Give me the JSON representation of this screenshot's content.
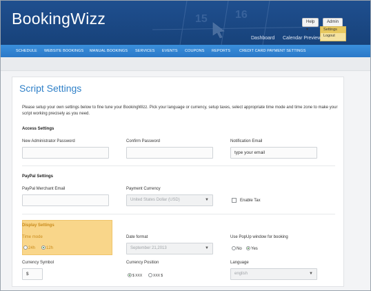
{
  "app": {
    "name": "BookingWizz"
  },
  "header": {
    "help_label": "Help",
    "admin_label": "Admin",
    "dropdown_items": [
      "Settings",
      "Logout"
    ],
    "links": [
      "Dashboard",
      "Calendar Preview"
    ],
    "calendar_numbers": [
      "15",
      "16"
    ]
  },
  "nav": {
    "items": [
      "SCHEDULE",
      "WEBSITE BOOKINGS",
      "MANUAL BOOKINGS",
      "SERVICES",
      "EVENTS",
      "COUPONS",
      "REPORTS",
      "CREDIT CARD PAYMENT SETTINGS"
    ]
  },
  "page": {
    "title": "Script Settings",
    "intro": "Please setup your own settings below to fine tune your BookingWizz. Pick your language or currency, setup taxes, select appropriate time mode and time zone to make your script working precisely as you need."
  },
  "access": {
    "heading": "Access Settings",
    "new_password_label": "New Administrator Password",
    "new_password_value": "",
    "confirm_password_label": "Confirm Password",
    "confirm_password_value": "",
    "notification_email_label": "Notification Email",
    "notification_email_value": "type your email"
  },
  "paypal": {
    "heading": "PayPal Settings",
    "merchant_email_label": "PayPal Merchant Email",
    "merchant_email_value": "",
    "currency_label": "Payment Currency",
    "currency_value": "United States Dollar (USD)",
    "tax_label": "Enable Tax",
    "tax_checked": false
  },
  "display": {
    "heading": "Display Settings",
    "time_mode_label": "Time mode",
    "time_mode_options": [
      "24h",
      "12h"
    ],
    "time_mode_selected": "12h",
    "date_format_label": "Date format",
    "date_format_value": "September 21,2013",
    "popup_label": "Use PopUp window for booking",
    "popup_options": [
      "No",
      "Yes"
    ],
    "popup_selected": "Yes",
    "currency_symbol_label": "Currency Symbol",
    "currency_symbol_value": "$",
    "currency_position_label": "Currency Position",
    "currency_position_options": [
      "$ XXX",
      "XXX $"
    ],
    "currency_position_selected": "$ XXX",
    "language_label": "Language",
    "language_value": "english"
  },
  "colors": {
    "header_blue": "#1f4f8f",
    "nav_blue": "#2b79c8",
    "title_blue": "#2f80c8",
    "highlight_yellow": "#f9d68a",
    "highlight_text": "#c98a1a"
  }
}
